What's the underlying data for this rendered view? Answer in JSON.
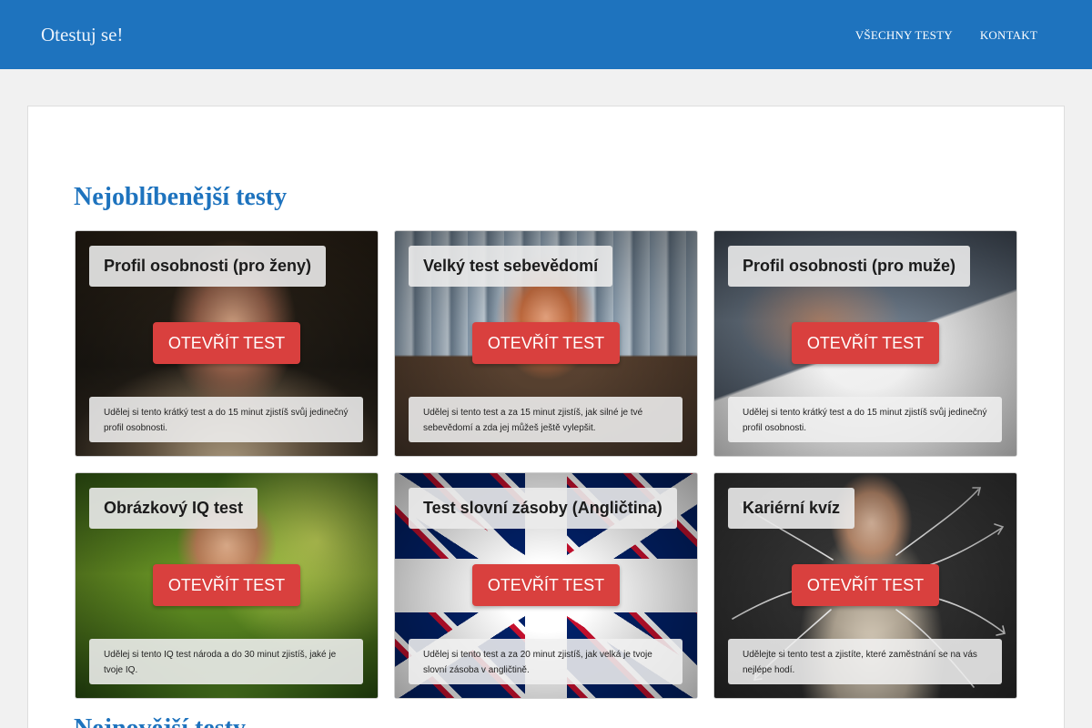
{
  "header": {
    "brand": "Otestuj se!",
    "nav": [
      {
        "label": "VŠECHNY TESTY"
      },
      {
        "label": "KONTAKT"
      }
    ]
  },
  "main": {
    "popular_title": "Nejoblíbenější testy",
    "newest_title": "Nejnovější testy",
    "cards": [
      {
        "title": "Profil osobnosti (pro ženy)",
        "button": "OTEVŘÍT TEST",
        "description": "Udělej si tento krátký test a do 15 minut zjistíš svůj jedinečný profil osobnosti."
      },
      {
        "title": "Velký test sebevědomí",
        "button": "OTEVŘÍT TEST",
        "description": "Udělej si tento test a za 15 minut zjistíš, jak silné je tvé sebevědomí a zda jej můžeš ještě vylepšit."
      },
      {
        "title": "Profil osobnosti (pro muže)",
        "button": "OTEVŘÍT TEST",
        "description": "Udělej si tento krátký test a do 15 minut zjistíš svůj jedinečný profil osobnosti."
      },
      {
        "title": "Obrázkový IQ test",
        "button": "OTEVŘÍT TEST",
        "description": "Udělej si tento IQ test národa a do 30 minut zjistíš, jaké je tvoje IQ."
      },
      {
        "title": "Test slovní zásoby (Angličtina)",
        "button": "OTEVŘÍT TEST",
        "description": "Udělej si tento test a za 20 minut zjistíš, jak velká je tvoje slovní zásoba v angličtině."
      },
      {
        "title": "Kariérní kvíz",
        "button": "OTEVŘÍT TEST",
        "description": "Udělejte si tento test a zjistíte, které zaměstnání se na vás nejlépe hodí."
      }
    ]
  },
  "colors": {
    "header_bg": "#1e73be",
    "section_title": "#1e73be",
    "button_bg": "#d9403e",
    "page_bg": "#f1f1f1"
  }
}
